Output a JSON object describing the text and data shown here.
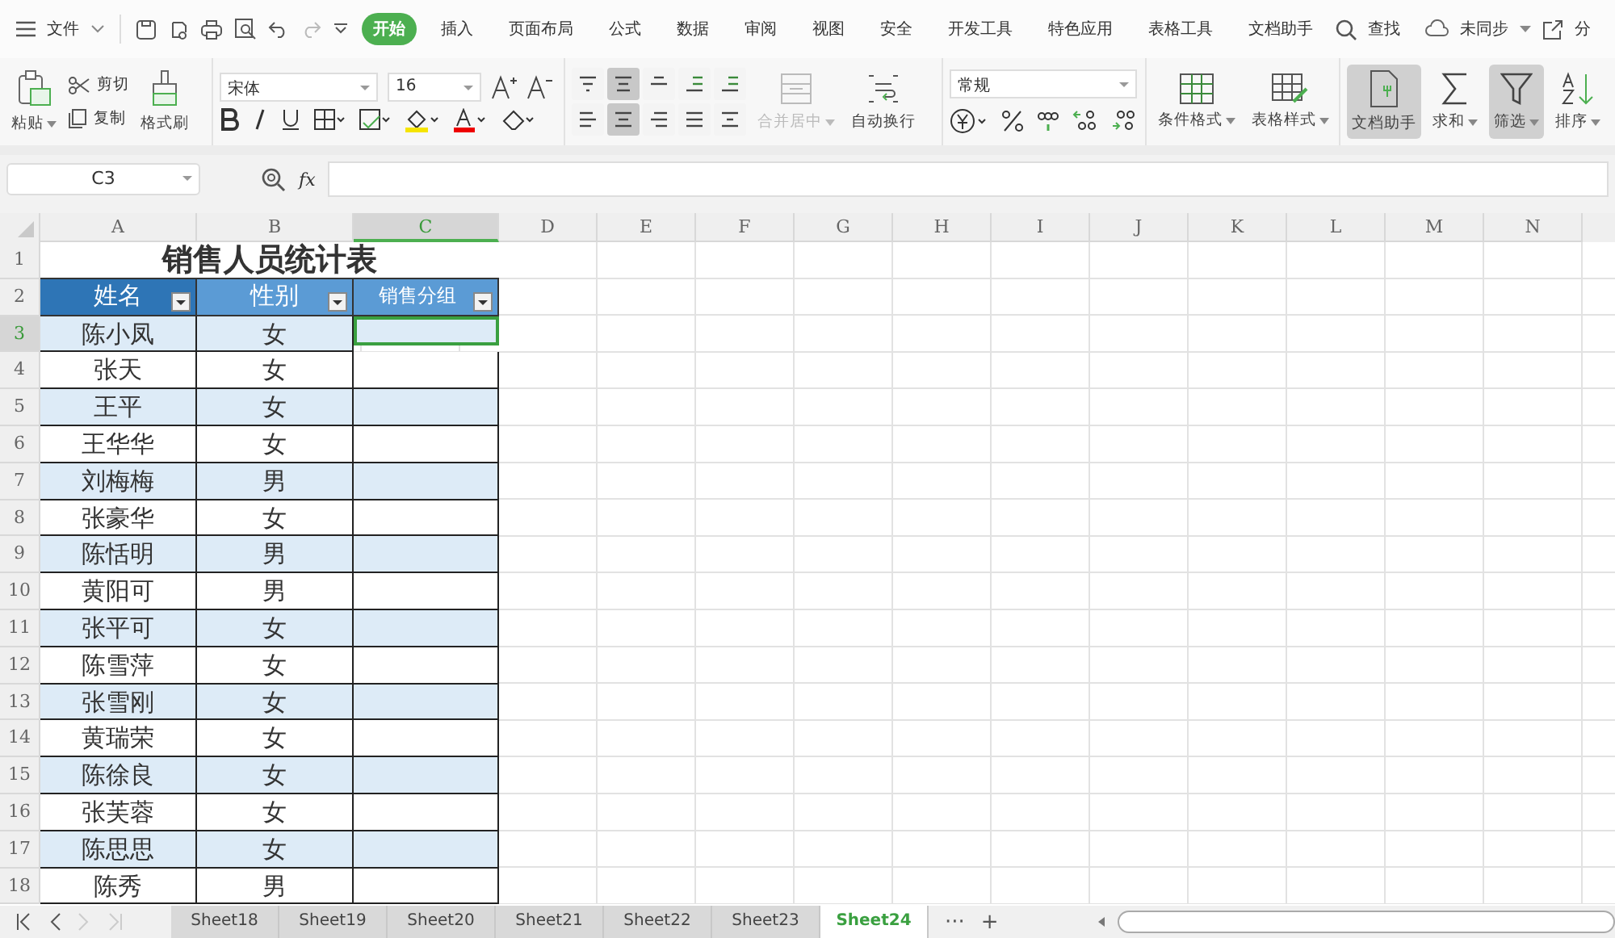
{
  "file_menu": "文件",
  "menu_tabs": [
    {
      "label": "开始",
      "selected": true
    },
    {
      "label": "插入",
      "selected": false
    },
    {
      "label": "页面布局",
      "selected": false
    },
    {
      "label": "公式",
      "selected": false
    },
    {
      "label": "数据",
      "selected": false
    },
    {
      "label": "审阅",
      "selected": false
    },
    {
      "label": "视图",
      "selected": false
    },
    {
      "label": "安全",
      "selected": false
    },
    {
      "label": "开发工具",
      "selected": false
    },
    {
      "label": "特色应用",
      "selected": false
    },
    {
      "label": "表格工具",
      "selected": false
    },
    {
      "label": "文档助手",
      "selected": false
    }
  ],
  "search": "查找",
  "sync": "未同步",
  "share": "分",
  "ribbon": {
    "paste": "粘贴",
    "cut": "剪切",
    "copy": "复制",
    "format_painter": "格式刷",
    "font": "宋体",
    "font_size": "16",
    "align_buttons": [
      {
        "selected": false
      },
      {
        "selected": true
      },
      {
        "selected": false
      },
      {
        "selected": false
      },
      {
        "selected": false
      },
      {
        "selected": false
      },
      {
        "selected": true
      },
      {
        "selected": false
      },
      {
        "selected": false
      },
      {
        "selected": false
      }
    ],
    "merge": {
      "label": "合并居中",
      "disabled": true
    },
    "wrap": "自动换行",
    "number_format": "常规",
    "conditional_format": "条件格式",
    "table_style": "表格样式",
    "doc_helper": {
      "label": "文档助手",
      "pressed": true
    },
    "sum": {
      "label": "求和",
      "pressed": false
    },
    "filter": {
      "label": "筛选",
      "pressed": true
    },
    "sort": {
      "label": "排序",
      "pressed": false
    }
  },
  "formula_bar": {
    "cell_ref": "C3",
    "fx": "fx"
  },
  "columns": [
    {
      "label": "A",
      "selected": false
    },
    {
      "label": "B",
      "selected": false
    },
    {
      "label": "C",
      "selected": true
    },
    {
      "label": "D",
      "selected": false
    },
    {
      "label": "E",
      "selected": false
    },
    {
      "label": "F",
      "selected": false
    },
    {
      "label": "G",
      "selected": false
    },
    {
      "label": "H",
      "selected": false
    },
    {
      "label": "I",
      "selected": false
    },
    {
      "label": "J",
      "selected": false
    },
    {
      "label": "K",
      "selected": false
    },
    {
      "label": "L",
      "selected": false
    },
    {
      "label": "M",
      "selected": false
    },
    {
      "label": "N",
      "selected": false
    }
  ],
  "title": {
    "row": "1",
    "text": "销售人员统计表"
  },
  "header": {
    "row": "2",
    "columns": [
      "姓名",
      "性别",
      "销售分组"
    ]
  },
  "rows": [
    {
      "row": "3",
      "name": "陈小凤",
      "gender": "女",
      "selected": true
    },
    {
      "row": "4",
      "name": "张天",
      "gender": "女",
      "selected": false
    },
    {
      "row": "5",
      "name": "王平",
      "gender": "女",
      "selected": false
    },
    {
      "row": "6",
      "name": "王华华",
      "gender": "女",
      "selected": false
    },
    {
      "row": "7",
      "name": "刘梅梅",
      "gender": "男",
      "selected": false
    },
    {
      "row": "8",
      "name": "张豪华",
      "gender": "女",
      "selected": false
    },
    {
      "row": "9",
      "name": "陈恬明",
      "gender": "男",
      "selected": false
    },
    {
      "row": "10",
      "name": "黄阳可",
      "gender": "男",
      "selected": false
    },
    {
      "row": "11",
      "name": "张平可",
      "gender": "女",
      "selected": false
    },
    {
      "row": "12",
      "name": "陈雪萍",
      "gender": "女",
      "selected": false
    },
    {
      "row": "13",
      "name": "张雪刚",
      "gender": "女",
      "selected": false
    },
    {
      "row": "14",
      "name": "黄瑞荣",
      "gender": "女",
      "selected": false
    },
    {
      "row": "15",
      "name": "陈徐良",
      "gender": "女",
      "selected": false
    },
    {
      "row": "16",
      "name": "张芙蓉",
      "gender": "女",
      "selected": false
    },
    {
      "row": "17",
      "name": "陈思思",
      "gender": "女",
      "selected": false
    },
    {
      "row": "18",
      "name": "陈秀",
      "gender": "男",
      "selected": false
    }
  ],
  "sheet_tabs": [
    {
      "label": "Sheet18",
      "selected": false
    },
    {
      "label": "Sheet19",
      "selected": false
    },
    {
      "label": "Sheet20",
      "selected": false
    },
    {
      "label": "Sheet21",
      "selected": false
    },
    {
      "label": "Sheet22",
      "selected": false
    },
    {
      "label": "Sheet23",
      "selected": false
    },
    {
      "label": "Sheet24",
      "selected": true
    }
  ],
  "more_sheets": "···",
  "add_sheet": "+"
}
